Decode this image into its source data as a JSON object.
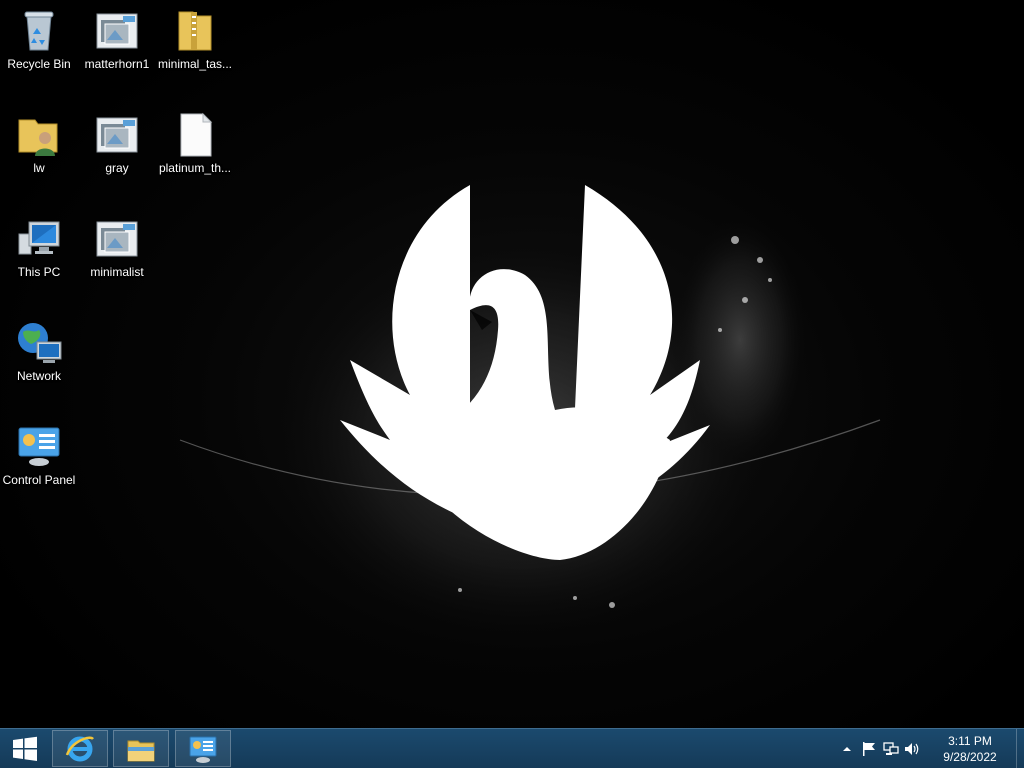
{
  "desktop": {
    "icons": [
      {
        "label": "Recycle Bin",
        "icon": "recycle-bin-icon"
      },
      {
        "label": "matterhorn1",
        "icon": "theme-file-icon"
      },
      {
        "label": "minimal_tas...",
        "icon": "zip-folder-icon"
      },
      {
        "label": "lw",
        "icon": "user-folder-icon"
      },
      {
        "label": "gray",
        "icon": "theme-file-icon"
      },
      {
        "label": "platinum_th...",
        "icon": "blank-file-icon"
      },
      {
        "label": "This PC",
        "icon": "computer-icon"
      },
      {
        "label": "minimalist",
        "icon": "theme-file-icon"
      },
      {
        "label": "Network",
        "icon": "network-globe-icon"
      },
      {
        "label": "Control Panel",
        "icon": "control-panel-icon"
      }
    ]
  },
  "taskbar": {
    "start": {
      "icon": "windows-logo-icon"
    },
    "pinned": [
      {
        "name": "Internet Explorer",
        "icon": "internet-explorer-icon"
      },
      {
        "name": "File Explorer",
        "icon": "file-explorer-icon"
      },
      {
        "name": "Control Panel",
        "icon": "control-panel-icon"
      }
    ],
    "tray": {
      "icons": [
        "show-hidden-icons-icon",
        "action-center-flag-icon",
        "network-icon",
        "volume-icon"
      ],
      "time": "3:11 PM",
      "date": "9/28/2022"
    }
  },
  "colors": {
    "taskbar": "#1b4a6e",
    "folder": "#e8c45a",
    "accent_blue": "#1e6fbf"
  }
}
